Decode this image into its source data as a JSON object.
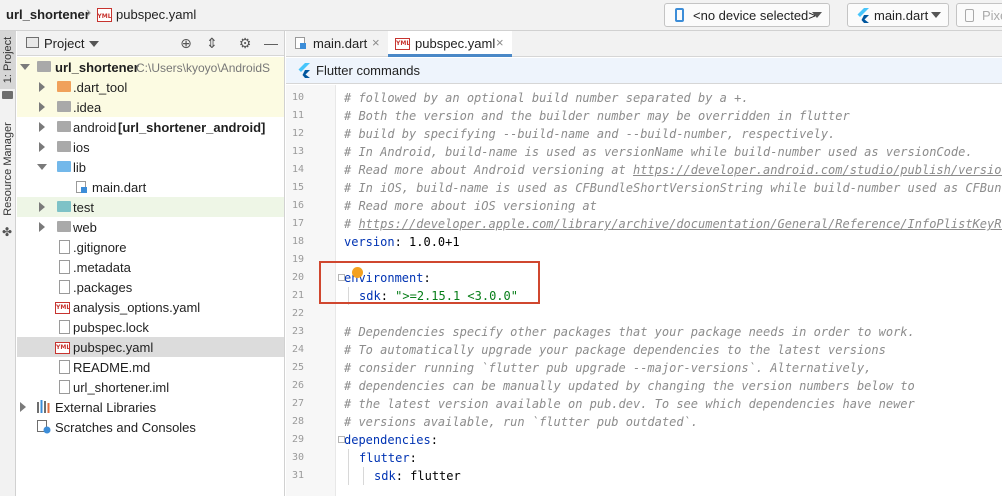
{
  "breadcrumb": {
    "project": "url_shortener",
    "file": "pubspec.yaml"
  },
  "toolbar": {
    "device": "<no device selected>",
    "run_config": "main.dart",
    "pixel": "Pixe"
  },
  "left_strip": {
    "project_tab": "1: Project",
    "resource_manager_tab": "Resource Manager"
  },
  "project_panel": {
    "title": "Project",
    "tree": [
      {
        "label": "url_shortener",
        "path": "C:\\Users\\kyoyo\\AndroidS",
        "icon": "folder-icon",
        "expanded": true
      },
      {
        "label": ".dart_tool",
        "icon": "folder-icon"
      },
      {
        "label": ".idea",
        "icon": "folder-icon"
      },
      {
        "label": "android",
        "suffix": "[url_shortener_android]",
        "icon": "folder-icon"
      },
      {
        "label": "ios",
        "icon": "folder-icon"
      },
      {
        "label": "lib",
        "icon": "folder-icon",
        "expanded": true
      },
      {
        "label": "main.dart",
        "icon": "dart-file-icon"
      },
      {
        "label": "test",
        "icon": "folder-icon"
      },
      {
        "label": "web",
        "icon": "folder-icon"
      },
      {
        "label": ".gitignore",
        "icon": "file-icon"
      },
      {
        "label": ".metadata",
        "icon": "file-icon"
      },
      {
        "label": ".packages",
        "icon": "file-icon"
      },
      {
        "label": "analysis_options.yaml",
        "icon": "yaml-file-icon"
      },
      {
        "label": "pubspec.lock",
        "icon": "file-icon"
      },
      {
        "label": "pubspec.yaml",
        "icon": "yaml-file-icon",
        "selected": true
      },
      {
        "label": "README.md",
        "icon": "markdown-file-icon"
      },
      {
        "label": "url_shortener.iml",
        "icon": "file-icon"
      },
      {
        "label": "External Libraries",
        "icon": "library-icon"
      },
      {
        "label": "Scratches and Consoles",
        "icon": "scratches-icon"
      }
    ]
  },
  "editor": {
    "tabs": [
      {
        "label": "main.dart",
        "close": "×"
      },
      {
        "label": "pubspec.yaml",
        "close": "×"
      }
    ],
    "banner": "Flutter commands",
    "lines": [
      {
        "num": "10",
        "text": "# followed by an optional build number separated by a +."
      },
      {
        "num": "11",
        "text": "# Both the version and the builder number may be overridden in flutter"
      },
      {
        "num": "12",
        "text": "# build by specifying --build-name and --build-number, respectively."
      },
      {
        "num": "13",
        "text": "# In Android, build-name is used as versionName while build-number used as versionCode."
      },
      {
        "num": "14",
        "text": "# Read more about Android versioning at ",
        "url": "https://developer.android.com/studio/publish/versionin"
      },
      {
        "num": "15",
        "text": "# In iOS, build-name is used as CFBundleShortVersionString while build-number used as CFBundle"
      },
      {
        "num": "16",
        "text": "# Read more about iOS versioning at"
      },
      {
        "num": "17",
        "text": "# ",
        "url": "https://developer.apple.com/library/archive/documentation/General/Reference/InfoPlistKeyRefe"
      },
      {
        "num": "18",
        "key": "version",
        "value": "1.0.0+1"
      },
      {
        "num": "19",
        "text": ""
      },
      {
        "num": "20",
        "key": "environment",
        "value": ""
      },
      {
        "num": "21",
        "key": "sdk",
        "value": "\">=2.15.1 <3.0.0\""
      },
      {
        "num": "22",
        "text": ""
      },
      {
        "num": "23",
        "text": "# Dependencies specify other packages that your package needs in order to work."
      },
      {
        "num": "24",
        "text": "# To automatically upgrade your package dependencies to the latest versions"
      },
      {
        "num": "25",
        "text": "# consider running `flutter pub upgrade --major-versions`. Alternatively,"
      },
      {
        "num": "26",
        "text": "# dependencies can be manually updated by changing the version numbers below to"
      },
      {
        "num": "27",
        "text": "# the latest version available on pub.dev. To see which dependencies have newer"
      },
      {
        "num": "28",
        "text": "# versions available, run `flutter pub outdated`."
      },
      {
        "num": "29",
        "key": "dependencies",
        "value": ""
      },
      {
        "num": "30",
        "key": "flutter",
        "value": ""
      },
      {
        "num": "31",
        "key": "sdk",
        "value": "flutter"
      }
    ]
  }
}
